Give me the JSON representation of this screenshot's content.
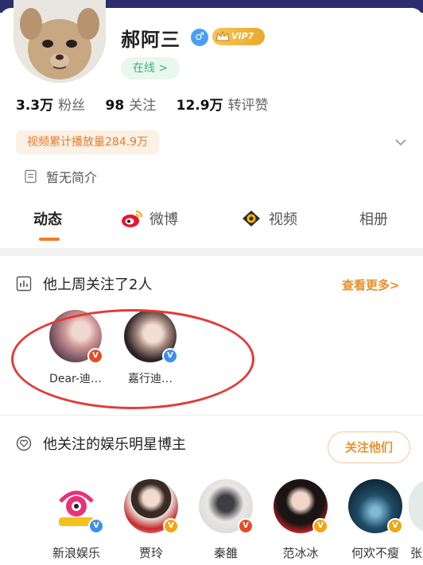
{
  "profile": {
    "name": "郝阿三",
    "gender_symbol": "♂",
    "vip_label": "VIP7",
    "online_label": "在线 >",
    "stats": [
      {
        "value": "3.3万",
        "label": "粉丝"
      },
      {
        "value": "98",
        "label": "关注"
      },
      {
        "value": "12.9万",
        "label": "转评赞"
      }
    ],
    "play_count": "视频累计播放量284.9万",
    "bio": "暂无简介"
  },
  "tabs": [
    {
      "label": "动态",
      "icon": null
    },
    {
      "label": "微博",
      "icon": "weibo-icon"
    },
    {
      "label": "视频",
      "icon": "video-icon"
    },
    {
      "label": "相册",
      "icon": null
    }
  ],
  "recent_follows": {
    "title": "他上周关注了2人",
    "see_more": "查看更多>",
    "users": [
      {
        "name": "Dear-迪…",
        "badge": "V",
        "badge_color": "#e84b24"
      },
      {
        "name": "嘉行迪…",
        "badge": "V",
        "badge_color": "#3d8ff0"
      }
    ]
  },
  "celebrities": {
    "title": "他关注的娱乐明星博主",
    "follow_button": "关注他们",
    "users": [
      {
        "name": "新浪娱乐",
        "badge": "V",
        "badge_color": "#3d8ff0"
      },
      {
        "name": "贾玲",
        "badge": "V",
        "badge_color": "#f2a514"
      },
      {
        "name": "秦雒",
        "badge": "V",
        "badge_color": "#e84b24"
      },
      {
        "name": "范冰冰",
        "badge": "V",
        "badge_color": "#f2a514"
      },
      {
        "name": "何欢不瘦",
        "badge": "V",
        "badge_color": "#f2a514"
      }
    ],
    "partial_name": "张"
  },
  "colors": {
    "accent_orange": "#e8902c",
    "online_green": "#3cb371",
    "annotation_red": "#e23a3a"
  }
}
